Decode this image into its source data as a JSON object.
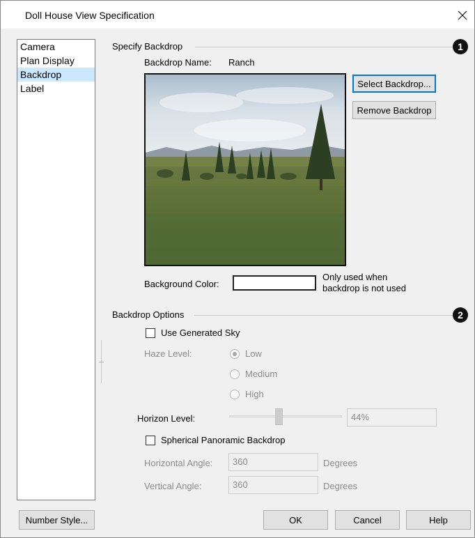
{
  "window": {
    "title": "Doll House View Specification"
  },
  "sidebar": {
    "items": [
      {
        "label": "Camera",
        "selected": false
      },
      {
        "label": "Plan Display",
        "selected": false
      },
      {
        "label": "Backdrop",
        "selected": true
      },
      {
        "label": "Label",
        "selected": false
      }
    ]
  },
  "specify_backdrop": {
    "group_label": "Specify Backdrop",
    "badge": "1",
    "name_label": "Backdrop Name:",
    "name_value": "Ranch",
    "select_button": "Select Backdrop...",
    "remove_button": "Remove Backdrop",
    "background_color_label": "Background Color:",
    "background_color_value": "#ffffff",
    "note_line1": "Only used when",
    "note_line2": "backdrop is not used"
  },
  "backdrop_options": {
    "group_label": "Backdrop Options",
    "badge": "2",
    "use_generated_sky_label": "Use Generated Sky",
    "use_generated_sky_checked": false,
    "haze_label": "Haze Level:",
    "haze_options": [
      "Low",
      "Medium",
      "High"
    ],
    "haze_selected": "Low",
    "horizon_label": "Horizon Level:",
    "horizon_value": "44%",
    "horizon_level": 0.44,
    "spherical_label": "Spherical Panoramic Backdrop",
    "spherical_checked": false,
    "horizontal_angle_label": "Horizontal Angle:",
    "horizontal_angle_value": "360",
    "vertical_angle_label": "Vertical Angle:",
    "vertical_angle_value": "360",
    "degrees_label": "Degrees"
  },
  "footer": {
    "number_style_button": "Number Style...",
    "ok_button": "OK",
    "cancel_button": "Cancel",
    "help_button": "Help"
  }
}
